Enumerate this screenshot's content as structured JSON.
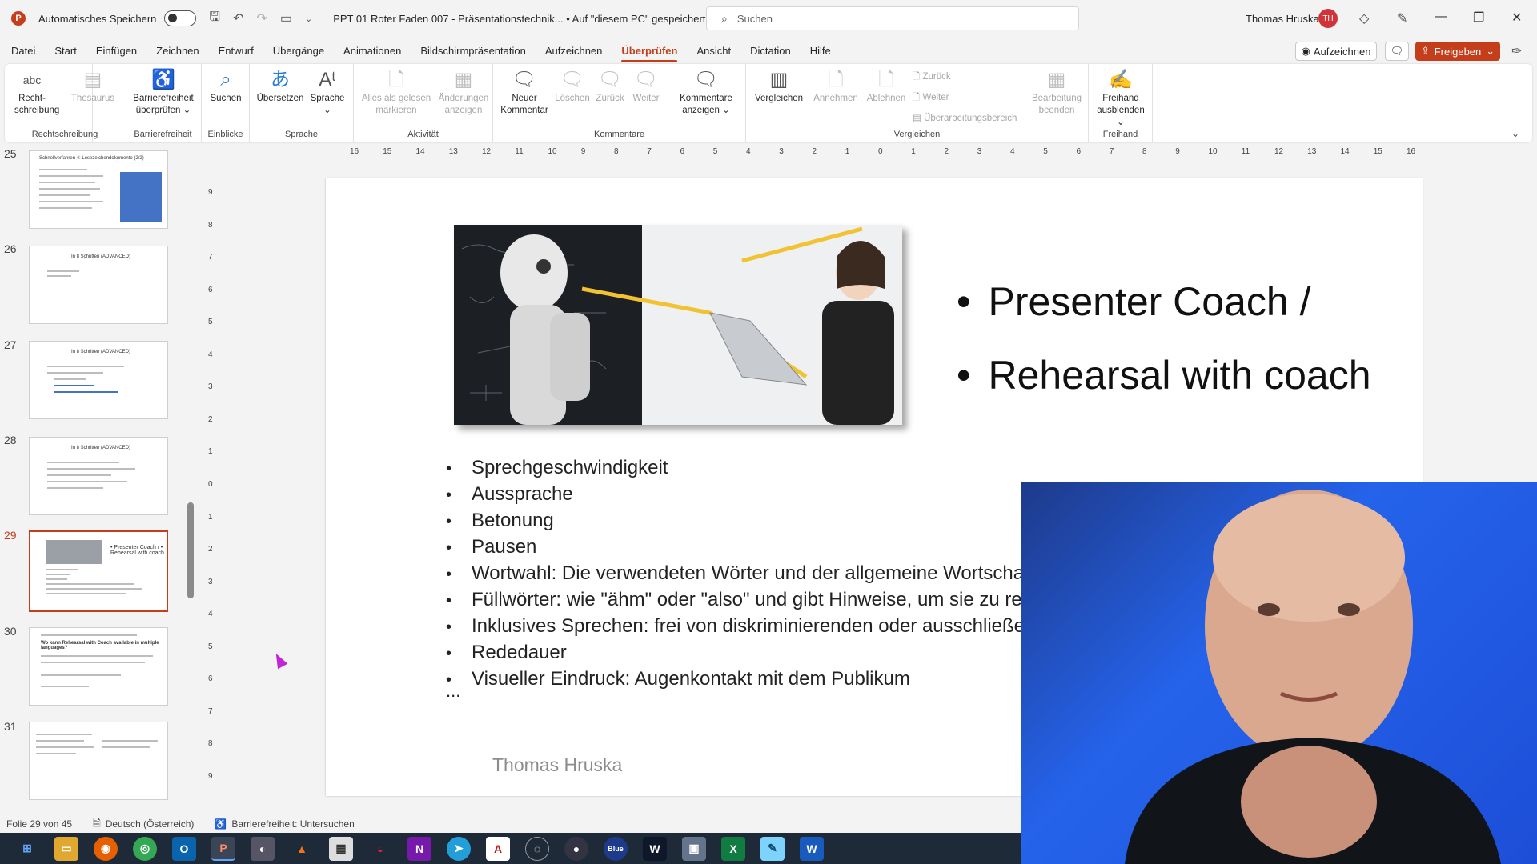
{
  "titlebar": {
    "autosave_label": "Automatisches Speichern",
    "document_title": "PPT 01 Roter Faden 007 - Präsentationstechnik...  •  Auf \"diesem PC\" gespeichert",
    "search_placeholder": "Suchen",
    "user_name": "Thomas Hruska",
    "user_initials": "TH"
  },
  "menu": {
    "tabs": [
      "Datei",
      "Start",
      "Einfügen",
      "Zeichnen",
      "Entwurf",
      "Übergänge",
      "Animationen",
      "Bildschirmpräsentation",
      "Aufzeichnen",
      "Überprüfen",
      "Ansicht",
      "Dictation",
      "Hilfe"
    ],
    "active_tab": "Überprüfen",
    "record_label": "Aufzeichnen",
    "share_label": "Freigeben"
  },
  "ribbon": {
    "groups": {
      "spelling": "Rechtschreibung",
      "accessibility": "Barrierefreiheit",
      "insights": "Einblicke",
      "language": "Sprache",
      "activity": "Aktivität",
      "comments": "Kommentare",
      "compare": "Vergleichen",
      "ink": "Freihand"
    },
    "buttons": {
      "spelling_l1": "Recht-",
      "spelling_l2": "schreibung",
      "spelling_icon_text": "abc",
      "thesaurus": "Thesaurus",
      "check_access_l1": "Barrierefreiheit",
      "check_access_l2": "überprüfen ⌄",
      "smart_lookup": "Suchen",
      "translate": "Übersetzen",
      "language_l1": "Sprache",
      "language_l2": "⌄",
      "mark_read_l1": "Alles als gelesen",
      "mark_read_l2": "markieren",
      "show_changes_l1": "Änderungen",
      "show_changes_l2": "anzeigen",
      "new_comment_l1": "Neuer",
      "new_comment_l2": "Kommentar",
      "delete": "Löschen",
      "previous": "Zurück",
      "next": "Weiter",
      "show_comments_l1": "Kommentare",
      "show_comments_l2": "anzeigen ⌄",
      "compare": "Vergleichen",
      "accept": "Annehmen",
      "reject": "Ablehnen",
      "back_small": "Zurück",
      "forward_small": "Weiter",
      "reviewing_pane": "Überarbeitungsbereich",
      "end_review_l1": "Bearbeitung",
      "end_review_l2": "beenden",
      "hide_ink_l1": "Freihand",
      "hide_ink_l2": "ausblenden ⌄"
    }
  },
  "thumbnails": [
    {
      "number": "25",
      "title": "Schnellverfahren 4: Lesezeichendokumente (2/2)"
    },
    {
      "number": "26",
      "title": "In 8 Schritten (ADVANCED)"
    },
    {
      "number": "27",
      "title": "In 8 Schritten (ADVANCED)"
    },
    {
      "number": "28",
      "title": "In 8 Schritten (ADVANCED)"
    },
    {
      "number": "29",
      "title": "• Presenter Coach /  • Rehearsal with coach"
    },
    {
      "number": "30",
      "title": "Wo kann Rehearsal with Coach available in multiple languages?"
    },
    {
      "number": "31",
      "title": ""
    }
  ],
  "ruler": {
    "horizontal": [
      "16",
      "15",
      "14",
      "13",
      "12",
      "11",
      "10",
      "9",
      "8",
      "7",
      "6",
      "5",
      "4",
      "3",
      "2",
      "1",
      "0",
      "1",
      "2",
      "3",
      "4",
      "5",
      "6",
      "7",
      "8",
      "9",
      "10",
      "11",
      "12",
      "13",
      "14",
      "15",
      "16"
    ],
    "vertical": [
      "9",
      "8",
      "7",
      "6",
      "5",
      "4",
      "3",
      "2",
      "1",
      "0",
      "1",
      "2",
      "3",
      "4",
      "5",
      "6",
      "7",
      "8",
      "9"
    ]
  },
  "slide": {
    "title_bullets": [
      "Presenter Coach /",
      "Rehearsal with coach"
    ],
    "content_bullets": [
      "Sprechgeschwindigkeit",
      "Aussprache",
      "Betonung",
      "Pausen",
      "Wortwahl: Die verwendeten Wörter und der allgemeine Wortscha",
      "Füllwörter: wie \"ähm\" oder \"also\" und gibt Hinweise, um sie zu re",
      "Inklusives Sprechen: frei von diskriminierenden oder ausschließen",
      "Rededauer",
      "Visueller Eindruck: Augenkontakt mit dem Publikum"
    ],
    "ellipsis": "...",
    "footer": "Thomas Hruska"
  },
  "status": {
    "slide_info": "Folie 29 von 45",
    "language": "Deutsch (Österreich)",
    "accessibility": "Barrierefreiheit: Untersuchen"
  },
  "colors": {
    "accent": "#c43e1c",
    "webcam_bg": "#2563eb",
    "taskbar": "#1f2a38"
  }
}
